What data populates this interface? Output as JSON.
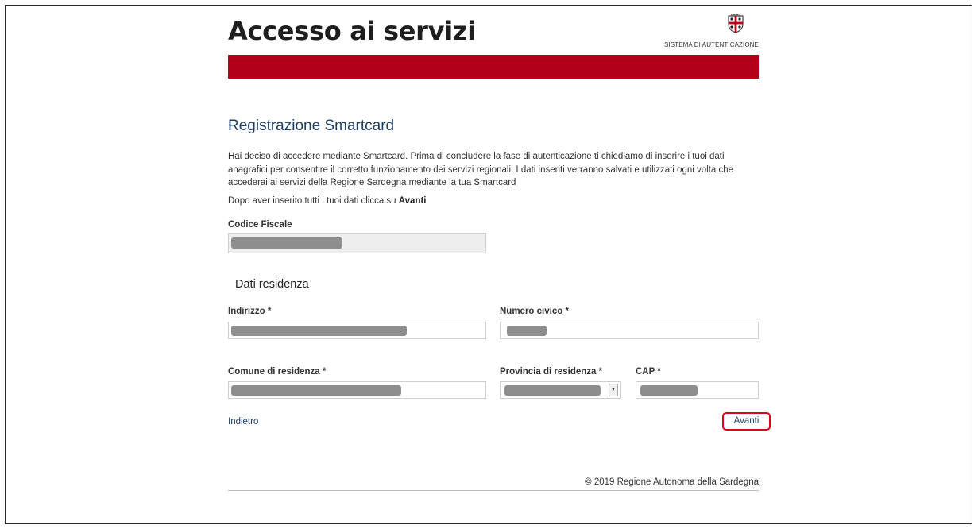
{
  "header": {
    "title": "Accesso ai servizi",
    "brand_caption": "SISTEMA DI AUTENTICAZIONE",
    "brand_icon": "sardinia-crest-icon",
    "accent_color": "#b30018"
  },
  "main": {
    "section_title": "Registrazione Smartcard",
    "intro": "Hai deciso di accedere mediante Smartcard. Prima di concludere la fase di autenticazione ti chiediamo di inserire i tuoi dati anagrafici per consentire il corretto funzionamento dei servizi regionali. I dati inseriti verranno salvati e utilizzati ogni volta che accederai ai servizi della Regione Sardegna mediante la tua Smartcard",
    "hint_prefix": "Dopo aver inserito tutti i tuoi dati clicca su ",
    "hint_bold": "Avanti"
  },
  "form": {
    "codice_fiscale_label": "Codice Fiscale",
    "residence_title": "Dati residenza",
    "indirizzo_label": "Indirizzo *",
    "numero_civico_label": "Numero civico *",
    "comune_label": "Comune di residenza *",
    "provincia_label": "Provincia di residenza *",
    "cap_label": "CAP *"
  },
  "actions": {
    "back_label": "Indietro",
    "next_label": "Avanti"
  },
  "footer": {
    "copyright": "© 2019 Regione Autonoma della Sardegna"
  }
}
